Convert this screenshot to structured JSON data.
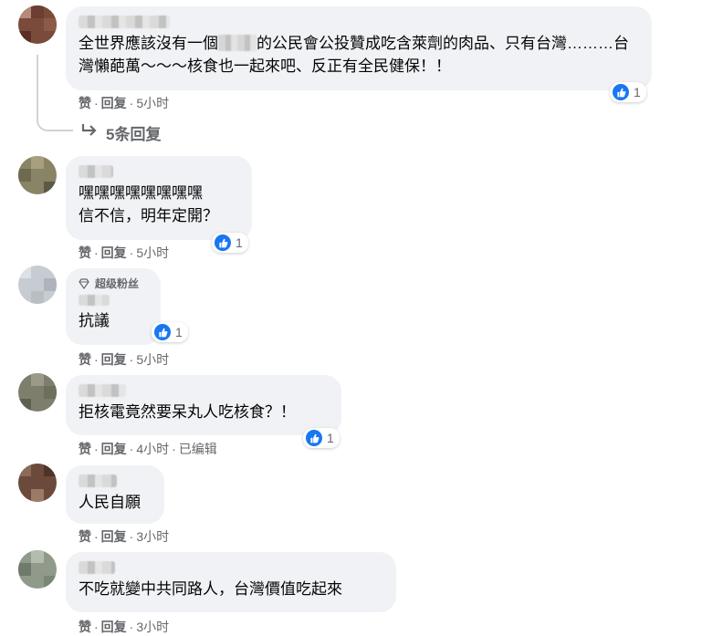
{
  "comments": [
    {
      "text_a": "全世界應該沒有一個",
      "text_b": "的公民會公投贊成吃含萊劑的肉品、只有台灣………台灣懶葩萬～～～核食也一起來吧、反正有全民健保！！",
      "like_label": "赞",
      "reply_label": "回复",
      "time": "5小时",
      "reactions": "1",
      "view_replies": "5条回复"
    },
    {
      "text": "嘿嘿嘿嘿嘿嘿嘿嘿\n信不信，明年定開？",
      "like_label": "赞",
      "reply_label": "回复",
      "time": "5小时",
      "reactions": "1"
    },
    {
      "badge": "超级粉丝",
      "text": "抗議",
      "like_label": "赞",
      "reply_label": "回复",
      "time": "5小时",
      "reactions": "1"
    },
    {
      "text": "拒核電竟然要呆丸人吃核食？！",
      "like_label": "赞",
      "reply_label": "回复",
      "time": "4小时",
      "edited": "已编辑",
      "reactions": "1"
    },
    {
      "text": "人民自願",
      "like_label": "赞",
      "reply_label": "回复",
      "time": "3小时"
    },
    {
      "text": "不吃就變中共同路人，台灣價值吃起來",
      "like_label": "赞",
      "reply_label": "回复",
      "time": "3小时"
    }
  ]
}
